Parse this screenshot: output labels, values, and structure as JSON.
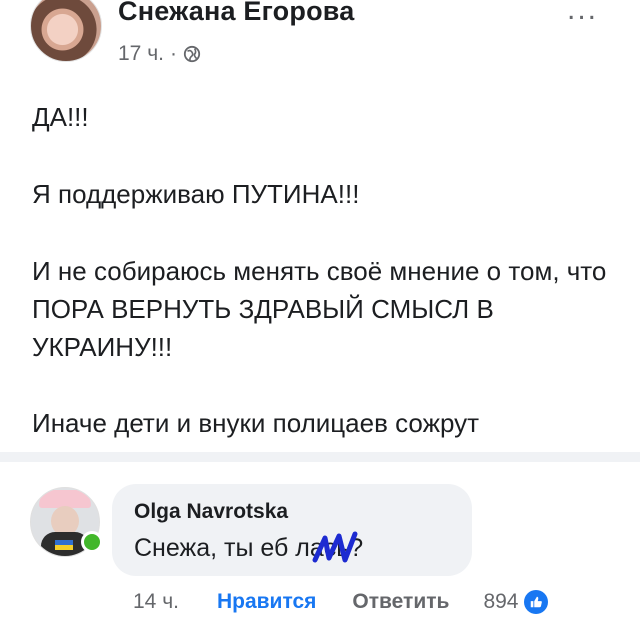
{
  "post": {
    "author": "Снежана Егорова",
    "time": "17 ч.",
    "separator": "·",
    "more": "...",
    "lines": [
      "ДА!!!",
      "Я поддерживаю ПУТИНА!!!",
      "И не собираюсь менять своё мнение о том, что ПОРА ВЕРНУТЬ ЗДРАВЫЙ СМЫСЛ В УКРАИНУ!!!",
      "Иначе дети и внуки полицаев сожрут"
    ]
  },
  "comment": {
    "author": "Olga Navrotska",
    "text": "Снежа, ты еб  лась?",
    "time": "14 ч.",
    "like_label": "Нравится",
    "reply_label": "Ответить",
    "reaction_count": "894"
  },
  "colors": {
    "accent": "#1877f2",
    "bubble": "#f0f2f5",
    "online": "#42b72a",
    "scribble": "#1d2bd1"
  },
  "icons": [
    "globe-icon",
    "more-icon",
    "online-dot",
    "like-badge-icon"
  ]
}
